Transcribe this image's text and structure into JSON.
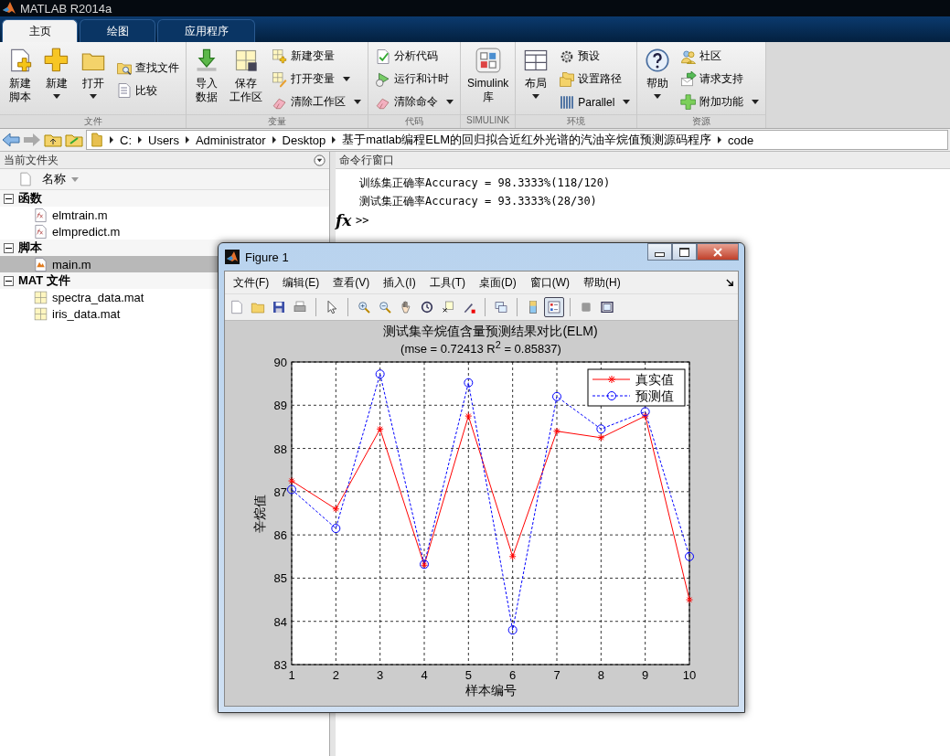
{
  "window": {
    "title": "MATLAB R2014a"
  },
  "tabs": [
    {
      "label": "主页",
      "selected": true
    },
    {
      "label": "绘图",
      "selected": false
    },
    {
      "label": "应用程序",
      "selected": false
    }
  ],
  "toolstrip": [
    {
      "title": "文件",
      "items": [
        {
          "kind": "large",
          "lines": [
            "新建",
            "脚本"
          ],
          "dropdown": false
        },
        {
          "kind": "large",
          "lines": [
            "新建"
          ],
          "dropdown": true
        },
        {
          "kind": "large",
          "lines": [
            "打开"
          ],
          "dropdown": true
        },
        {
          "kind": "column",
          "items": [
            {
              "label": "查找文件",
              "dropdown": false
            },
            {
              "label": "比较",
              "dropdown": false
            }
          ]
        }
      ]
    },
    {
      "title": "变量",
      "items": [
        {
          "kind": "large",
          "lines": [
            "导入",
            "数据"
          ],
          "dropdown": false
        },
        {
          "kind": "large",
          "lines": [
            "保存",
            "工作区"
          ],
          "dropdown": false
        },
        {
          "kind": "column",
          "items": [
            {
              "label": "新建变量",
              "dropdown": false
            },
            {
              "label": "打开变量",
              "dropdown": true
            },
            {
              "label": "清除工作区",
              "dropdown": true
            }
          ]
        }
      ]
    },
    {
      "title": "代码",
      "items": [
        {
          "kind": "column",
          "items": [
            {
              "label": "分析代码",
              "dropdown": false
            },
            {
              "label": "运行和计时",
              "dropdown": false
            },
            {
              "label": "清除命令",
              "dropdown": true
            }
          ]
        }
      ]
    },
    {
      "title": "SIMULINK",
      "items": [
        {
          "kind": "large",
          "lines": [
            "Simulink",
            "库"
          ],
          "dropdown": false
        }
      ]
    },
    {
      "title": "环境",
      "items": [
        {
          "kind": "large",
          "lines": [
            "布局"
          ],
          "dropdown": true
        },
        {
          "kind": "column",
          "items": [
            {
              "label": "预设",
              "dropdown": false
            },
            {
              "label": "设置路径",
              "dropdown": false
            },
            {
              "label": "Parallel",
              "dropdown": true
            }
          ]
        }
      ]
    },
    {
      "title": "资源",
      "items": [
        {
          "kind": "large",
          "lines": [
            "帮助"
          ],
          "dropdown": true
        },
        {
          "kind": "column",
          "items": [
            {
              "label": "社区",
              "dropdown": false
            },
            {
              "label": "请求支持",
              "dropdown": false
            },
            {
              "label": "附加功能",
              "dropdown": true
            }
          ]
        }
      ]
    }
  ],
  "address_bar": {
    "path": [
      "C:",
      "Users",
      "Administrator",
      "Desktop",
      "基于matlab编程ELM的回归拟合近红外光谱的汽油辛烷值预测源码程序",
      "code"
    ]
  },
  "current_folder": {
    "title": "当前文件夹",
    "column": "名称",
    "groups": [
      {
        "label": "函数",
        "expanded": true,
        "children": [
          {
            "name": "elmtrain.m",
            "selected": false
          },
          {
            "name": "elmpredict.m",
            "selected": false
          }
        ]
      },
      {
        "label": "脚本",
        "expanded": true,
        "children": [
          {
            "name": "main.m",
            "selected": true
          }
        ]
      },
      {
        "label": "MAT 文件",
        "expanded": true,
        "children": [
          {
            "name": "spectra_data.mat",
            "selected": false
          },
          {
            "name": "iris_data.mat",
            "selected": false
          }
        ]
      }
    ]
  },
  "command_window": {
    "title": "命令行窗口",
    "lines": [
      "训练集正确率Accuracy = 98.3333%(118/120)",
      "测试集正确率Accuracy = 93.3333%(28/30)"
    ],
    "prompt": ">>",
    "function_button": "fx"
  },
  "figure": {
    "title": "Figure 1",
    "menus": [
      "文件(F)",
      "编辑(E)",
      "查看(V)",
      "插入(I)",
      "工具(T)",
      "桌面(D)",
      "窗口(W)",
      "帮助(H)"
    ],
    "toolbar": [
      {
        "selected": false
      },
      {
        "selected": false
      },
      {
        "selected": false
      },
      {
        "selected": false
      },
      {
        "selected": false
      },
      {
        "selected": false
      },
      {
        "selected": false
      },
      {
        "selected": false
      },
      {
        "selected": false
      },
      {
        "selected": false
      },
      {
        "selected": false
      },
      {
        "selected": false
      },
      {
        "selected": false
      },
      {
        "selected": true
      },
      {
        "selected": false
      },
      {
        "selected": false
      }
    ],
    "chart_data": {
      "type": "line",
      "title": "测试集辛烷值含量预测结果对比(ELM)",
      "subtitle": "(mse = 0.72413 R$^{2}$ = 0.85837)",
      "xlabel": "样本编号",
      "ylabel": "辛烷值",
      "grid": true,
      "legend": true,
      "x": [
        1,
        2,
        3,
        4,
        5,
        6,
        7,
        8,
        9,
        10
      ],
      "xlim": [
        1,
        10
      ],
      "ylim": [
        83,
        90
      ],
      "xticks": [
        1,
        2,
        3,
        4,
        5,
        6,
        7,
        8,
        9,
        10
      ],
      "yticks": [
        83,
        84,
        85,
        86,
        87,
        88,
        89,
        90
      ],
      "series": [
        {
          "name": "真实值",
          "color": "#ff0000",
          "marker": "cross",
          "line_style": "solid",
          "values": [
            87.25,
            86.6,
            88.45,
            85.3,
            88.75,
            85.5,
            88.4,
            88.25,
            88.75,
            84.5
          ]
        },
        {
          "name": "预测值",
          "color": "#0000ff",
          "marker": "circle",
          "line_style": "dashed",
          "values": [
            87.05,
            86.15,
            89.72,
            85.32,
            89.52,
            83.8,
            89.2,
            88.45,
            88.85,
            85.5
          ]
        }
      ]
    }
  }
}
